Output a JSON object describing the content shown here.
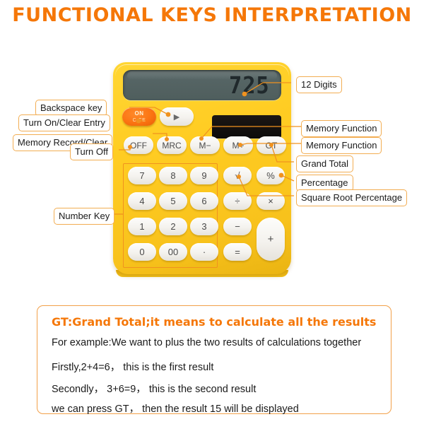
{
  "page": {
    "title": "FUNCTIONAL KEYS INTERPRETATION",
    "accent_color": "#f57708",
    "label_border_color": "#f2ad52",
    "calculator_body_color": "#ffcc22",
    "lcd_color": "#556464",
    "key_color": "#f4f2ee",
    "on_key_color": "#fb7412"
  },
  "calculator": {
    "display": {
      "value": "725",
      "digits_capacity": "12"
    },
    "solar_panel": "solar-panel",
    "keys": {
      "on_ce": {
        "top": "ON",
        "bottom": "C CE"
      },
      "backspace": "▶",
      "off": "OFF",
      "mrc": "MRC",
      "m_minus": "M−",
      "m_plus": "M+",
      "gt": "GT",
      "sqrt": "√",
      "percent": "%",
      "divide": "÷",
      "multiply": "×",
      "minus": "−",
      "equals": "=",
      "plus": "+",
      "numbers": [
        "7",
        "8",
        "9",
        "4",
        "5",
        "6",
        "1",
        "2",
        "3",
        "0",
        "00",
        "·"
      ]
    }
  },
  "callouts": {
    "left": [
      {
        "id": "backspace",
        "text": "Backspace key"
      },
      {
        "id": "on_clear_entry",
        "text": "Turn On/Clear Entry"
      },
      {
        "id": "memory_record_clear",
        "text": "Memory Record/Clear"
      },
      {
        "id": "turn_off",
        "text": "Turn Off"
      },
      {
        "id": "number_key",
        "text": "Number Key"
      }
    ],
    "right": [
      {
        "id": "digits",
        "text": "12 Digits"
      },
      {
        "id": "memory_function_1",
        "text": "Memory Function"
      },
      {
        "id": "memory_function_2",
        "text": "Memory Function"
      },
      {
        "id": "grand_total",
        "text": "Grand Total"
      },
      {
        "id": "percentage",
        "text": "Percentage"
      },
      {
        "id": "square_root_percentage",
        "text": "Square Root Percentage"
      }
    ]
  },
  "note": {
    "title": "GT:Grand Total;it means to calculate all the results",
    "lines": [
      "For example:We want to plus the two  results of calculations together",
      "Firstly,2+4=6， this is the first result",
      "Secondly， 3+6=9， this is the second result",
      "we can press GT， then the result 15 will be displayed"
    ]
  }
}
